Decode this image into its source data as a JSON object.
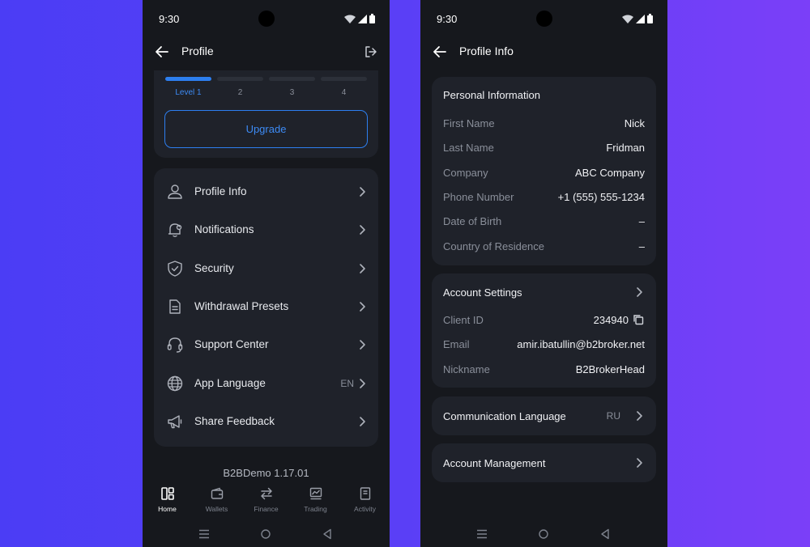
{
  "colors": {
    "background_gradient_start": "#4b3df5",
    "background_gradient_end": "#7b3ff8",
    "phone_bg": "#16181d",
    "card_bg": "#1f222a",
    "accent": "#2d7ff0",
    "muted": "#8a8f9a"
  },
  "left": {
    "status": {
      "time": "9:30"
    },
    "header": {
      "title": "Profile",
      "back_icon": "arrow-left-icon",
      "logout_icon": "logout-icon"
    },
    "levels": {
      "current": 1,
      "total": 4,
      "labels": [
        "Level 1",
        "2",
        "3",
        "4"
      ]
    },
    "upgrade_label": "Upgrade",
    "menu": [
      {
        "label": "Profile Info",
        "icon": "user-icon",
        "value": ""
      },
      {
        "label": "Notifications",
        "icon": "bell-icon",
        "value": ""
      },
      {
        "label": "Security",
        "icon": "shield-icon",
        "value": ""
      },
      {
        "label": "Withdrawal Presets",
        "icon": "document-icon",
        "value": ""
      },
      {
        "label": "Support Center",
        "icon": "headset-icon",
        "value": ""
      },
      {
        "label": "App Language",
        "icon": "globe-icon",
        "value": "EN"
      },
      {
        "label": "Share Feedback",
        "icon": "megaphone-icon",
        "value": ""
      }
    ],
    "version": "B2BDemo 1.17.01",
    "tabs": [
      {
        "label": "Home",
        "icon": "dashboard-icon",
        "active": true
      },
      {
        "label": "Wallets",
        "icon": "wallet-icon",
        "active": false
      },
      {
        "label": "Finance",
        "icon": "transfer-icon",
        "active": false
      },
      {
        "label": "Trading",
        "icon": "chart-icon",
        "active": false
      },
      {
        "label": "Activity",
        "icon": "list-icon",
        "active": false
      }
    ]
  },
  "right": {
    "status": {
      "time": "9:30"
    },
    "header": {
      "title": "Profile Info",
      "back_icon": "arrow-left-icon"
    },
    "personal": {
      "title": "Personal Information",
      "rows": [
        {
          "label": "First Name",
          "value": "Nick"
        },
        {
          "label": "Last Name",
          "value": "Fridman"
        },
        {
          "label": "Company",
          "value": "ABC Company"
        },
        {
          "label": "Phone Number",
          "value": "+1 (555) 555-1234"
        },
        {
          "label": "Date of Birth",
          "value": "–"
        },
        {
          "label": "Country of Residence",
          "value": "–"
        }
      ]
    },
    "account_settings": {
      "title": "Account Settings",
      "rows": [
        {
          "label": "Client ID",
          "value": "234940",
          "icon": "copy-icon"
        },
        {
          "label": "Email",
          "value": "amir.ibatullin@b2broker.net"
        },
        {
          "label": "Nickname",
          "value": "B2BrokerHead"
        }
      ]
    },
    "communication": {
      "label": "Communication Language",
      "value": "RU"
    },
    "management": {
      "label": "Account Management"
    }
  }
}
